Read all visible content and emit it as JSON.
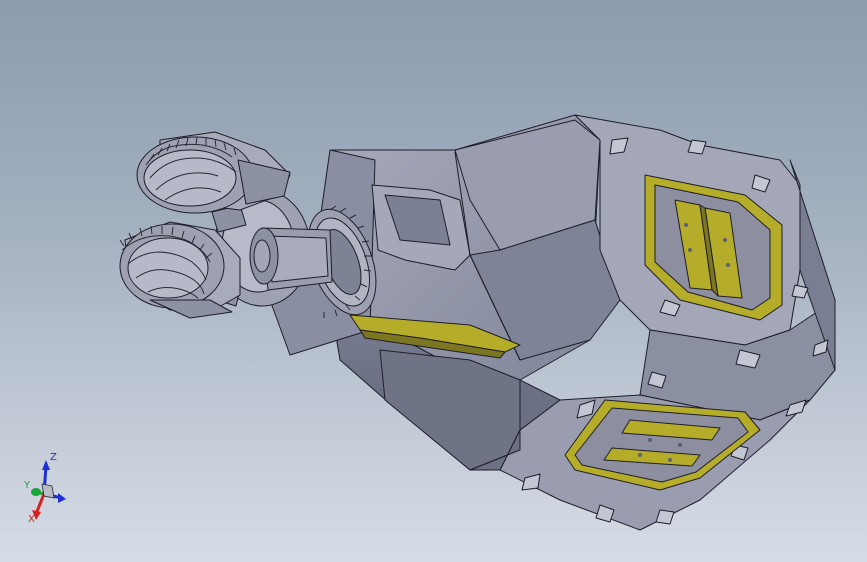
{
  "viewport": {
    "background_top": "#8c9bae",
    "background_bottom": "#d7dde6"
  },
  "model": {
    "body_color": "#8f93a6",
    "body_dark": "#6e7285",
    "body_light": "#b2b5c4",
    "edge_color": "#1e1e28",
    "highlight_color": "#b5ac2a",
    "highlight_dark": "#7d7620"
  },
  "triad": {
    "z_label": "Z",
    "y_label": "Y",
    "x_label": "X",
    "z_color": "#1f2fd6",
    "y_color": "#1aa53b",
    "x_color": "#d62020"
  }
}
